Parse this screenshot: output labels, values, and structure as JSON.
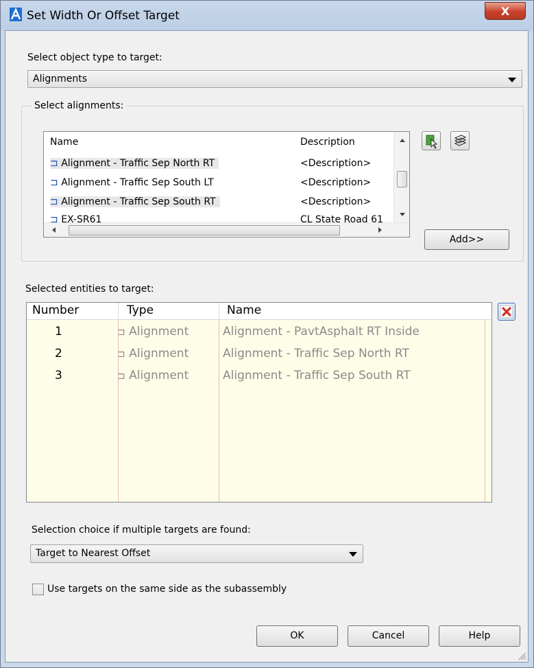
{
  "window": {
    "title": "Set Width Or Offset Target",
    "close_label": "X"
  },
  "object_type": {
    "label": "Select object type to target:",
    "value": "Alignments"
  },
  "alignments": {
    "group_label": "Select alignments:",
    "columns": {
      "name": "Name",
      "description": "Description"
    },
    "rows": [
      {
        "name": "Alignment - Traffic Sep North RT",
        "description": "<Description>"
      },
      {
        "name": "Alignment - Traffic Sep South LT",
        "description": "<Description>"
      },
      {
        "name": "Alignment - Traffic Sep South RT",
        "description": "<Description>"
      },
      {
        "name": "EX-SR61",
        "description": "CL State Road 61"
      }
    ],
    "add_label": "Add>>"
  },
  "selected": {
    "label": "Selected entities to target:",
    "columns": {
      "number": "Number",
      "type": "Type",
      "name": "Name"
    },
    "rows": [
      {
        "number": "1",
        "type": "Alignment",
        "name": "Alignment - PavtAsphalt RT Inside"
      },
      {
        "number": "2",
        "type": "Alignment",
        "name": "Alignment - Traffic Sep North RT"
      },
      {
        "number": "3",
        "type": "Alignment",
        "name": "Alignment - Traffic Sep South RT"
      }
    ]
  },
  "selection_choice": {
    "label": "Selection choice if multiple targets are found:",
    "value": "Target to Nearest Offset"
  },
  "same_side": {
    "label": "Use targets on the same side as the subassembly",
    "checked": false
  },
  "buttons": {
    "ok": "OK",
    "cancel": "Cancel",
    "help": "Help"
  },
  "colors": {
    "grid_background": "#fefde8",
    "column_line": "#e8b8b8",
    "delete_icon": "#d0302a"
  }
}
